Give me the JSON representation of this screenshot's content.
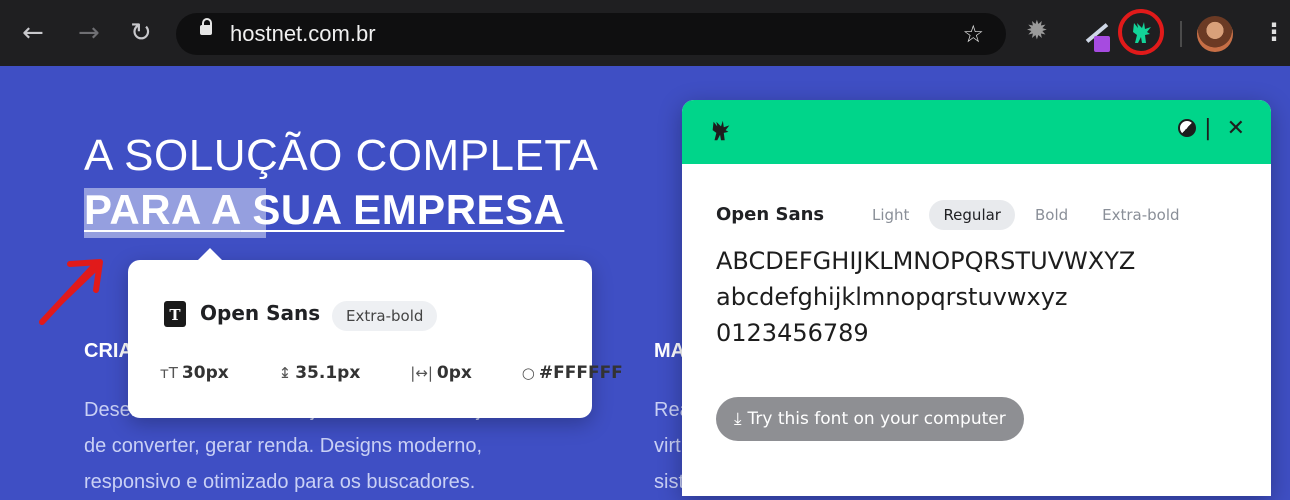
{
  "browser": {
    "url": "hostnet.com.br",
    "icons": [
      "back-arrow-icon",
      "forward-arrow-icon",
      "reload-icon",
      "lock-icon",
      "star-icon",
      "gear-icon",
      "pen-icon",
      "dinosaur-icon",
      "avatar",
      "kebab-menu-icon"
    ]
  },
  "page": {
    "hero_line1": "A SOLUÇÃO COMPLETA",
    "hero_line2_highlight": "PARA A",
    "hero_line2_rest": " SUA EMPRESA",
    "col1_title": "CRIAÇÃO DE SITES",
    "col1_lines": [
      "Desenvolvemos sites e lojas virtuais com objetivo",
      "de converter, gerar renda. Designs moderno,",
      "responsivo e otimizado para os buscadores."
    ],
    "col2_title": "MA",
    "col2_lines": [
      "Rea",
      "virt",
      "sist"
    ]
  },
  "tooltip": {
    "font_name": "Open Sans",
    "weight_badge": "Extra-bold",
    "font_size": "30px",
    "line_height": "35.1px",
    "letter_spacing": "0px",
    "color": "#FFFFFF"
  },
  "panel": {
    "font_name": "Open Sans",
    "weights": [
      "Light",
      "Regular",
      "Bold",
      "Extra-bold"
    ],
    "selected_weight": "Regular",
    "specimen_upper": "ABCDEFGHIJKLMNOPQRSTUVWXYZ",
    "specimen_lower": "abcdefghijklmnopqrstuvwxyz",
    "specimen_digits": "0123456789",
    "try_button": "Try this font on your computer",
    "close_glyph": "✕",
    "divider_glyph": "|"
  },
  "colors": {
    "page_bg": "#3f4fc4",
    "panel_header": "#00d58a",
    "highlight_ring": "#e11a1a"
  }
}
